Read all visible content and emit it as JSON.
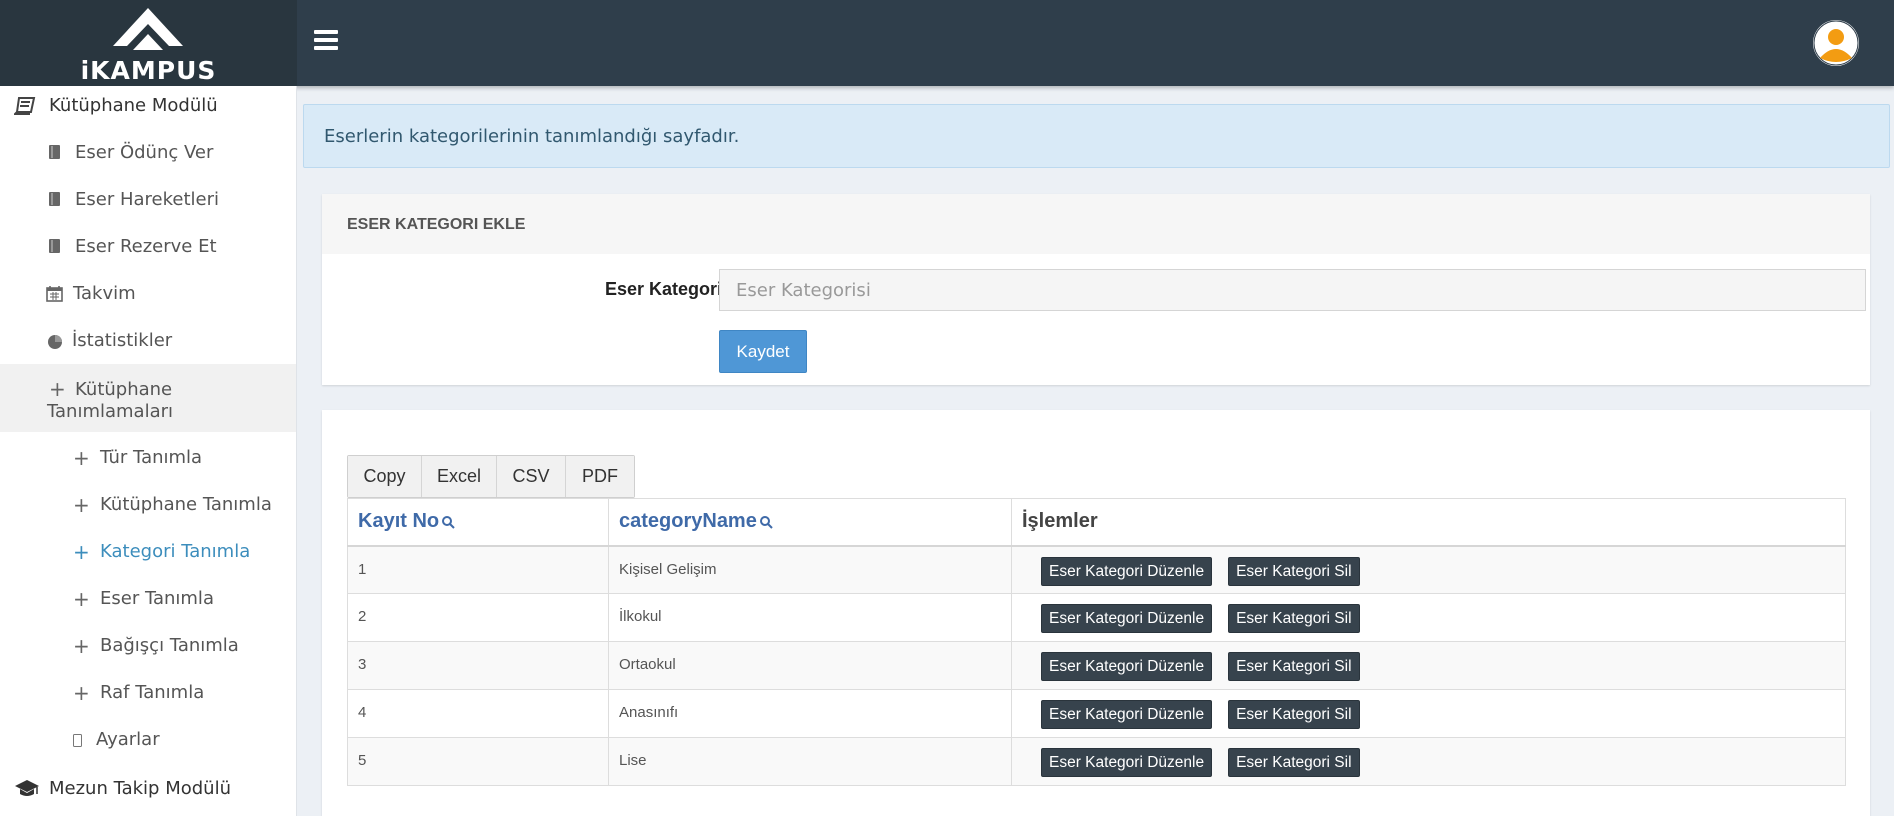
{
  "header": {
    "logo_text": "iKAMPUS"
  },
  "sidebar": {
    "module_library": "Kütüphane Modülü",
    "items": [
      {
        "label": "Eser Ödünç Ver"
      },
      {
        "label": "Eser Hareketleri"
      },
      {
        "label": "Eser Rezerve Et"
      },
      {
        "label": "Takvim"
      },
      {
        "label": "İstatistikler"
      }
    ],
    "definitions_group": {
      "label_line1": "Kütüphane",
      "label_line2": "Tanımlamaları"
    },
    "sub_items": [
      {
        "label": "Tür Tanımla"
      },
      {
        "label": "Kütüphane Tanımla"
      },
      {
        "label": "Kategori Tanımla"
      },
      {
        "label": "Eser Tanımla"
      },
      {
        "label": "Bağışçı Tanımla"
      },
      {
        "label": "Raf Tanımla"
      },
      {
        "label": "Ayarlar"
      }
    ],
    "module_alumni": "Mezun Takip Modülü"
  },
  "callout": {
    "text": "Eserlerin kategorilerinin tanımlandığı sayfadır."
  },
  "form": {
    "title": "ESER KATEGORI EKLE",
    "label": "Eser Kategori",
    "placeholder": "Eser Kategorisi",
    "value": "",
    "submit_label": "Kaydet"
  },
  "export": {
    "buttons": [
      "Copy",
      "Excel",
      "CSV",
      "PDF"
    ]
  },
  "table": {
    "headers": [
      "Kayıt No",
      "categoryName",
      "İşlemler"
    ],
    "edit_label": "Eser Kategori Düzenle",
    "delete_label": "Eser Kategori Sil",
    "rows": [
      {
        "id": "1",
        "name": "Kişisel Gelişim"
      },
      {
        "id": "2",
        "name": "İlkokul"
      },
      {
        "id": "3",
        "name": "Ortaokul"
      },
      {
        "id": "4",
        "name": "Anasınıfı"
      },
      {
        "id": "5",
        "name": "Lise"
      }
    ]
  },
  "colors": {
    "header_bg": "#2f3e4b",
    "accent": "#3c8dbc",
    "primary_button": "#4f97d6",
    "dark_button": "#37434d",
    "avatar": "#f39c12"
  }
}
